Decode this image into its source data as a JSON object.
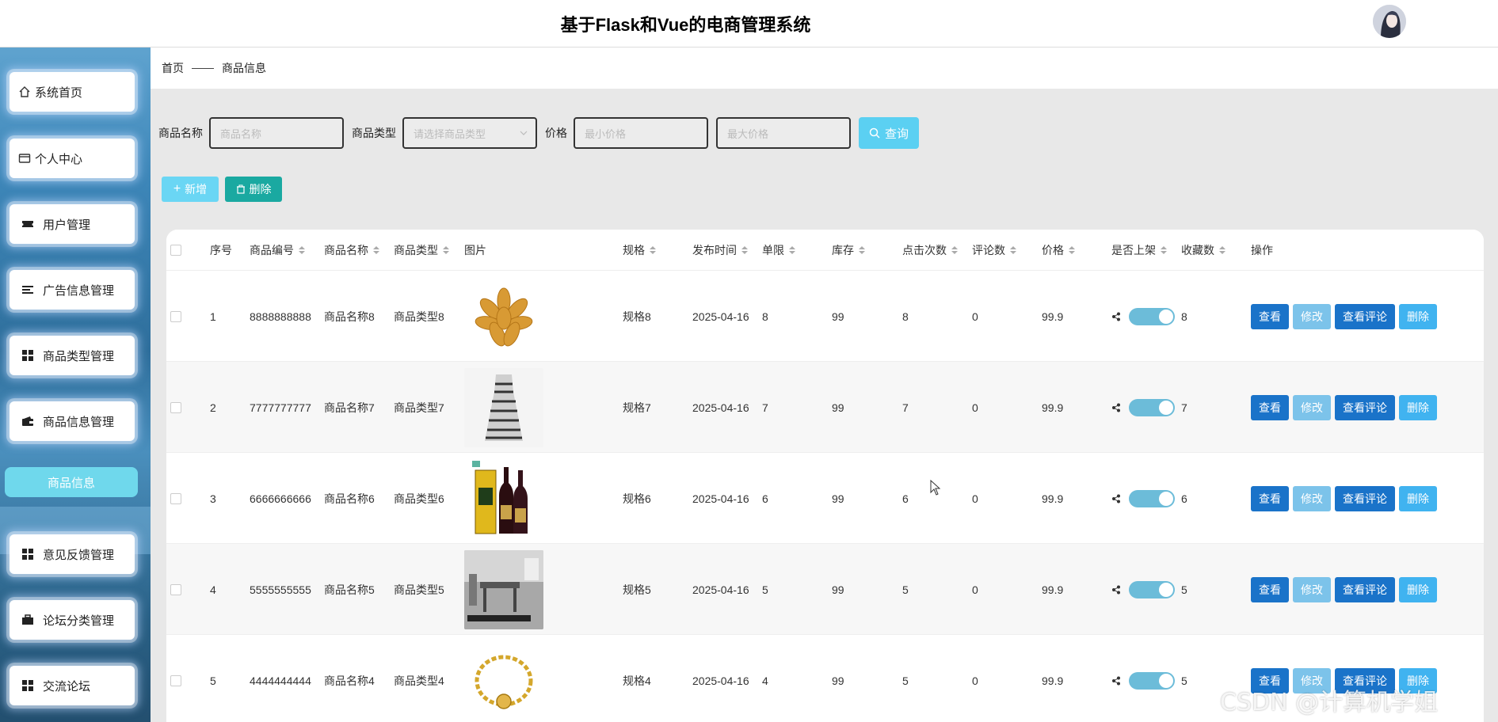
{
  "header": {
    "title": "基于Flask和Vue的电商管理系统"
  },
  "sidebar": {
    "items": [
      {
        "label": "系统首页",
        "icon": "home-icon"
      },
      {
        "label": "个人中心",
        "icon": "card-icon"
      },
      {
        "label": "用户管理",
        "icon": "ticket-icon"
      },
      {
        "label": "广告信息管理",
        "icon": "list-icon"
      },
      {
        "label": "商品类型管理",
        "icon": "grid-icon"
      },
      {
        "label": "商品信息管理",
        "icon": "wallet-icon"
      },
      {
        "label": "意见反馈管理",
        "icon": "grid-icon"
      },
      {
        "label": "论坛分类管理",
        "icon": "briefcase-icon"
      },
      {
        "label": "交流论坛",
        "icon": "grid-icon"
      }
    ],
    "active_sub": "商品信息"
  },
  "breadcrumb": {
    "home": "首页",
    "current": "商品信息"
  },
  "search": {
    "name_label": "商品名称",
    "name_placeholder": "商品名称",
    "type_label": "商品类型",
    "type_placeholder": "请选择商品类型",
    "price_label": "价格",
    "min_placeholder": "最小价格",
    "max_placeholder": "最大价格",
    "query_label": "查询"
  },
  "actions": {
    "add_label": "新增",
    "delete_label": "删除"
  },
  "table": {
    "headers": [
      "序号",
      "商品编号",
      "商品名称",
      "商品类型",
      "图片",
      "规格",
      "发布时间",
      "单限",
      "库存",
      "点击次数",
      "评论数",
      "价格",
      "是否上架",
      "收藏数",
      "操作"
    ],
    "rows": [
      {
        "index": "1",
        "code": "8888888888",
        "name": "商品名称8",
        "type": "商品类型8",
        "spec": "规格8",
        "date": "2025-04-16",
        "limit": "8",
        "stock": "99",
        "clicks": "8",
        "comments": "0",
        "price": "99.9",
        "favorites": "8",
        "image": "dates-image"
      },
      {
        "index": "2",
        "code": "7777777777",
        "name": "商品名称7",
        "type": "商品类型7",
        "spec": "规格7",
        "date": "2025-04-16",
        "limit": "7",
        "stock": "99",
        "clicks": "7",
        "comments": "0",
        "price": "99.9",
        "favorites": "7",
        "image": "dress-image"
      },
      {
        "index": "3",
        "code": "6666666666",
        "name": "商品名称6",
        "type": "商品类型6",
        "spec": "规格6",
        "date": "2025-04-16",
        "limit": "6",
        "stock": "99",
        "clicks": "6",
        "comments": "0",
        "price": "99.9",
        "favorites": "6",
        "image": "wine-image"
      },
      {
        "index": "4",
        "code": "5555555555",
        "name": "商品名称5",
        "type": "商品类型5",
        "spec": "规格5",
        "date": "2025-04-16",
        "limit": "5",
        "stock": "99",
        "clicks": "5",
        "comments": "0",
        "price": "99.9",
        "favorites": "5",
        "image": "furniture-image"
      },
      {
        "index": "5",
        "code": "4444444444",
        "name": "商品名称4",
        "type": "商品类型4",
        "spec": "规格4",
        "date": "2025-04-16",
        "limit": "4",
        "stock": "99",
        "clicks": "5",
        "comments": "0",
        "price": "99.9",
        "favorites": "5",
        "image": "bracelet-image"
      }
    ],
    "ops": {
      "view": "查看",
      "edit": "修改",
      "comments": "查看评论",
      "delete": "删除"
    }
  },
  "watermark": "CSDN @计算机学姐",
  "colors": {
    "query": "#5bd0f2",
    "primary": "#1a73c9",
    "teal": "#1aa9a1",
    "active_sub": "#6fd8ec"
  }
}
